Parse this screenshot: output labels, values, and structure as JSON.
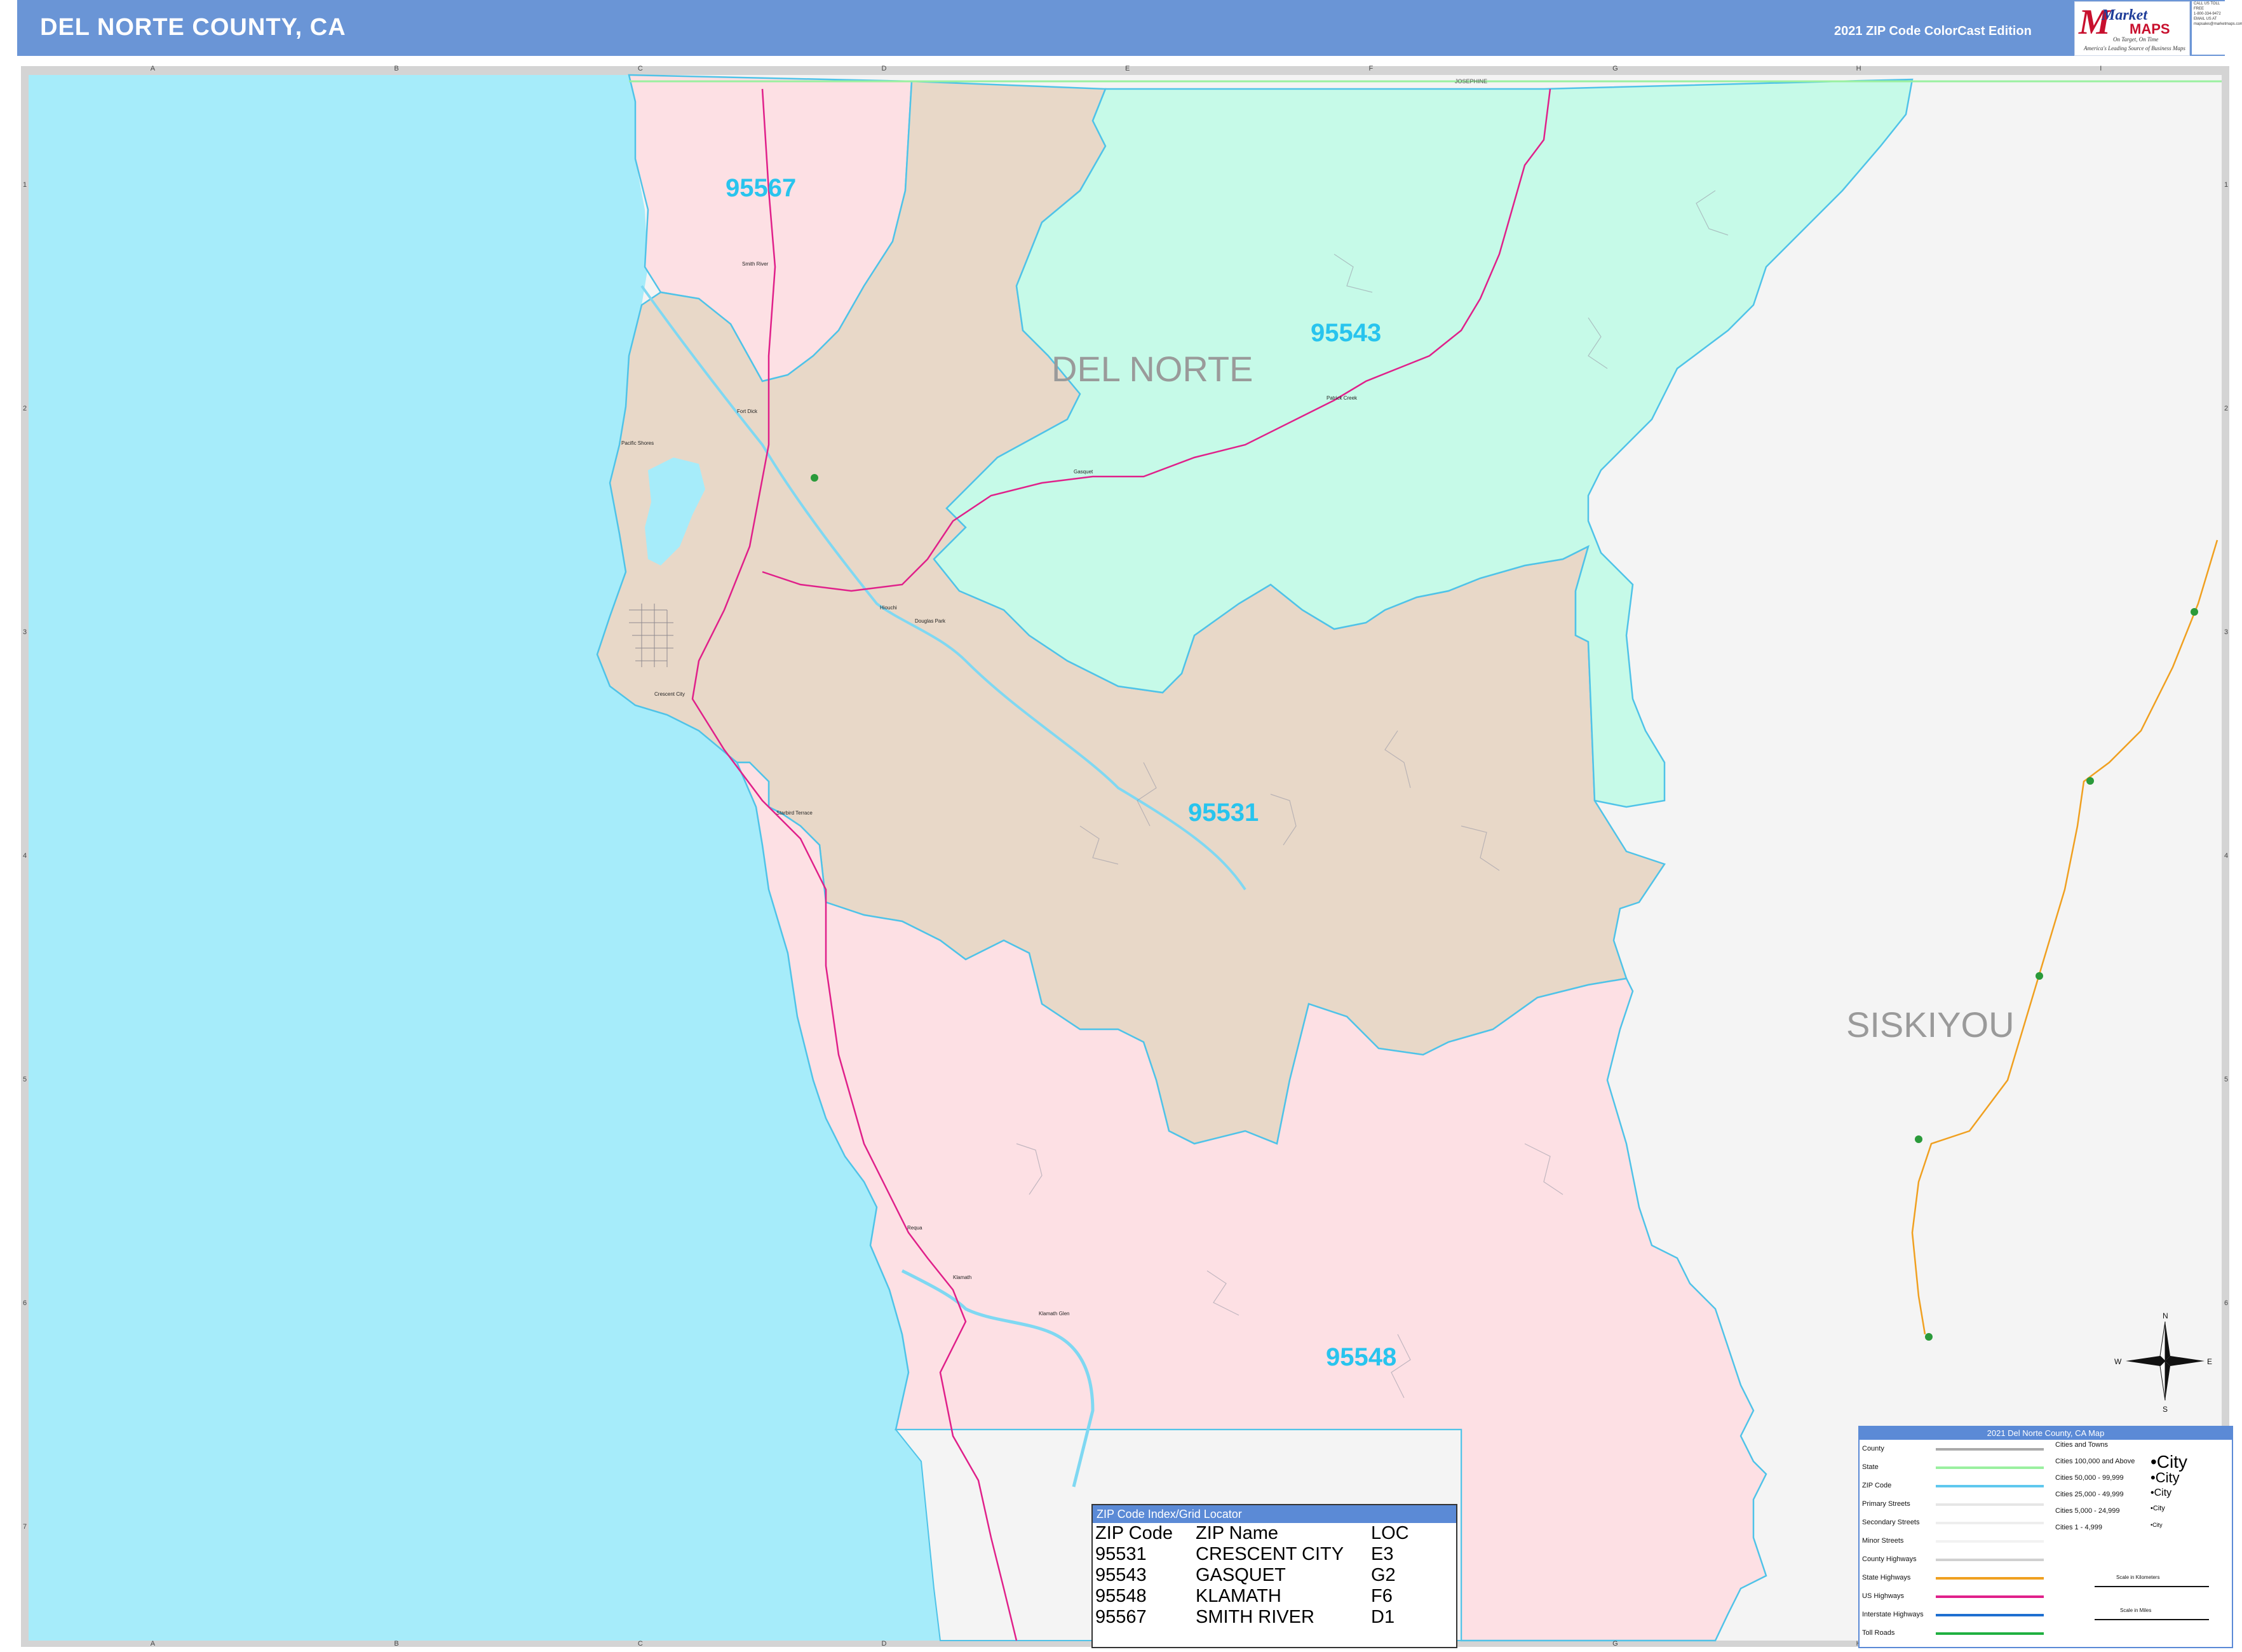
{
  "header": {
    "title": "DEL NORTE COUNTY, CA",
    "edition": "2021 ZIP Code ColorCast Edition",
    "logo": {
      "name": "Market",
      "maps": "MAPS",
      "tagline1": "On Target, On Time",
      "tagline2": "America's Leading Source of Business Maps"
    },
    "contact": [
      "CALL US TOLL FREE",
      "1-800-334-9472",
      "EMAIL US AT",
      "mapsales@marketmaps.com"
    ]
  },
  "grid": {
    "columns": [
      "A",
      "B",
      "C",
      "D",
      "E",
      "F",
      "G",
      "H",
      "I"
    ],
    "rows": [
      "1",
      "2",
      "3",
      "4",
      "5",
      "6",
      "7"
    ]
  },
  "map": {
    "ocean_color": "#a6ecfa",
    "zip_colors": {
      "95531": "#e8d8c8",
      "95543": "#c6fae8",
      "95548": "#fde0e4",
      "95567": "#fde0e4"
    },
    "zip_labels": [
      "95567",
      "95543",
      "95531",
      "95548"
    ],
    "county_labels": [
      "DEL NORTE",
      "SISKIYOU"
    ],
    "top_label": "JOSEPHINE",
    "towns": [
      "Smith River",
      "Fort Dick",
      "Pacific Shores",
      "Hiouchi",
      "Douglas Park",
      "Gasquet",
      "Patrick Creek",
      "Crescent City",
      "Klamath Glen",
      "Requa",
      "Klamath",
      "Starbird Terrace"
    ]
  },
  "compass": {
    "n": "N",
    "s": "S",
    "e": "E",
    "w": "W"
  },
  "zip_index": {
    "title": "ZIP Code Index/Grid Locator",
    "headers": [
      "ZIP Code",
      "ZIP Name",
      "LOC"
    ],
    "rows": [
      [
        "95531",
        "CRESCENT CITY",
        "E3"
      ],
      [
        "95543",
        "GASQUET",
        "G2"
      ],
      [
        "95548",
        "KLAMATH",
        "F6"
      ],
      [
        "95567",
        "SMITH RIVER",
        "D1"
      ]
    ]
  },
  "legend": {
    "title": "2021 Del Norte County, CA Map",
    "items": [
      {
        "label": "County",
        "color": "#aaaaaa"
      },
      {
        "label": "State",
        "color": "#9af0a0"
      },
      {
        "label": "ZIP Code",
        "color": "#5fc8ee"
      },
      {
        "label": "Primary Streets",
        "color": "#e6e6e6"
      },
      {
        "label": "Secondary Streets",
        "color": "#eeeeee"
      },
      {
        "label": "Minor Streets",
        "color": "#f2f2f2"
      },
      {
        "label": "County Highways",
        "color": "#d0d0d0"
      },
      {
        "label": "State Highways",
        "color": "#f0a020"
      },
      {
        "label": "US Highways",
        "color": "#e0208a"
      },
      {
        "label": "Interstate Highways",
        "color": "#1e6fd0"
      },
      {
        "label": "Toll Roads",
        "color": "#20b040"
      }
    ],
    "cities": [
      {
        "label": "Cities and Towns",
        "sym": ""
      },
      {
        "label": "Cities 100,000 and Above",
        "sym": "•City"
      },
      {
        "label": "Cities 50,000 - 99,999",
        "sym": "•City"
      },
      {
        "label": "Cities 25,000 - 49,999",
        "sym": "•City"
      },
      {
        "label": "Cities 5,000 - 24,999",
        "sym": "•City"
      },
      {
        "label": "Cities 1 - 4,999",
        "sym": "•City"
      }
    ],
    "scale_km": "Scale in Kilometers",
    "scale_mi": "Scale in Miles"
  }
}
